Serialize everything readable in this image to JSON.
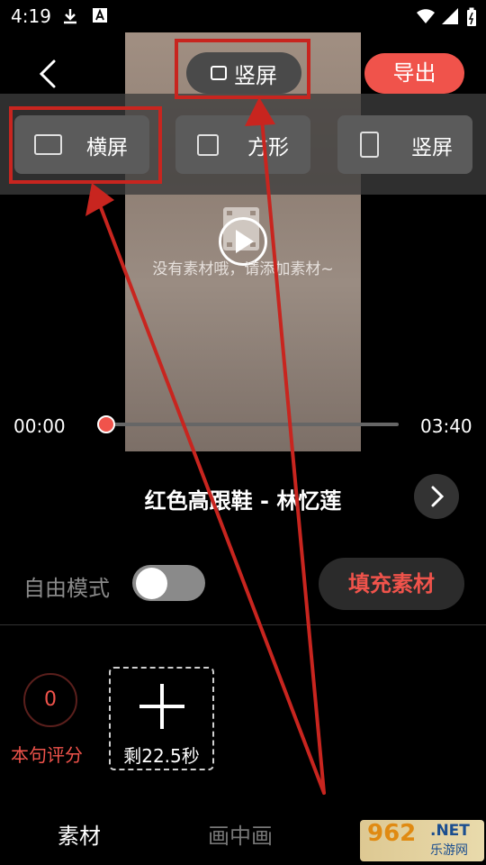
{
  "status_bar": {
    "time": "4:19"
  },
  "topbar": {
    "ratio_label": "竖屏",
    "export_label": "导出"
  },
  "aspect_options": [
    {
      "label": "横屏"
    },
    {
      "label": "方形"
    },
    {
      "label": "竖屏"
    }
  ],
  "preview": {
    "empty_text": "没有素材哦，请添加素材~"
  },
  "timeline": {
    "start": "00:00",
    "end": "03:40",
    "progress": 0
  },
  "song": {
    "title": "红色高跟鞋 - 林忆莲"
  },
  "controls": {
    "free_mode_label": "自由模式",
    "free_mode_on": false,
    "fill_button": "填充素材"
  },
  "clip": {
    "score": "0",
    "score_label": "本句评分",
    "remaining": "剩22.5秒"
  },
  "tabs": [
    {
      "label": "素材",
      "active": true
    },
    {
      "label": "画中画",
      "active": false
    }
  ],
  "watermark": {
    "num": "962",
    "net": ".NET",
    "cn": "乐游网"
  },
  "colors": {
    "accent": "#f0534b",
    "annotation": "#c8251f"
  }
}
